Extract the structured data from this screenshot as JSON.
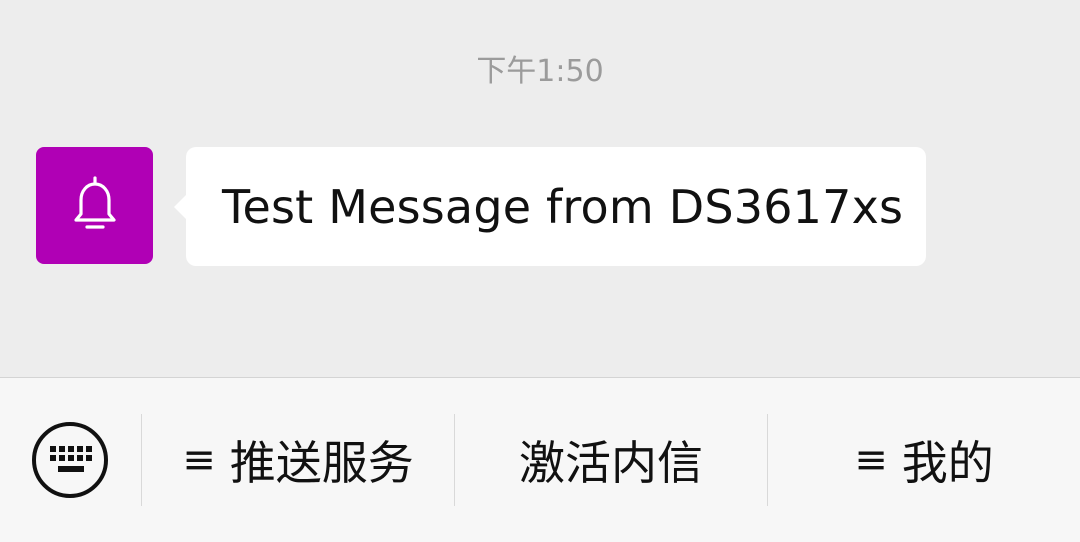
{
  "chat": {
    "timestamp": "下午1:50",
    "message": {
      "avatar_icon": "bell-icon",
      "avatar_color": "#b000b5",
      "text": "Test Message from DS3617xs"
    }
  },
  "bottom_bar": {
    "keyboard_icon": "keyboard-icon",
    "menus": [
      {
        "icon": "≡",
        "label": "推送服务"
      },
      {
        "icon": "",
        "label": "激活内信"
      },
      {
        "icon": "≡",
        "label": "我的"
      }
    ]
  }
}
